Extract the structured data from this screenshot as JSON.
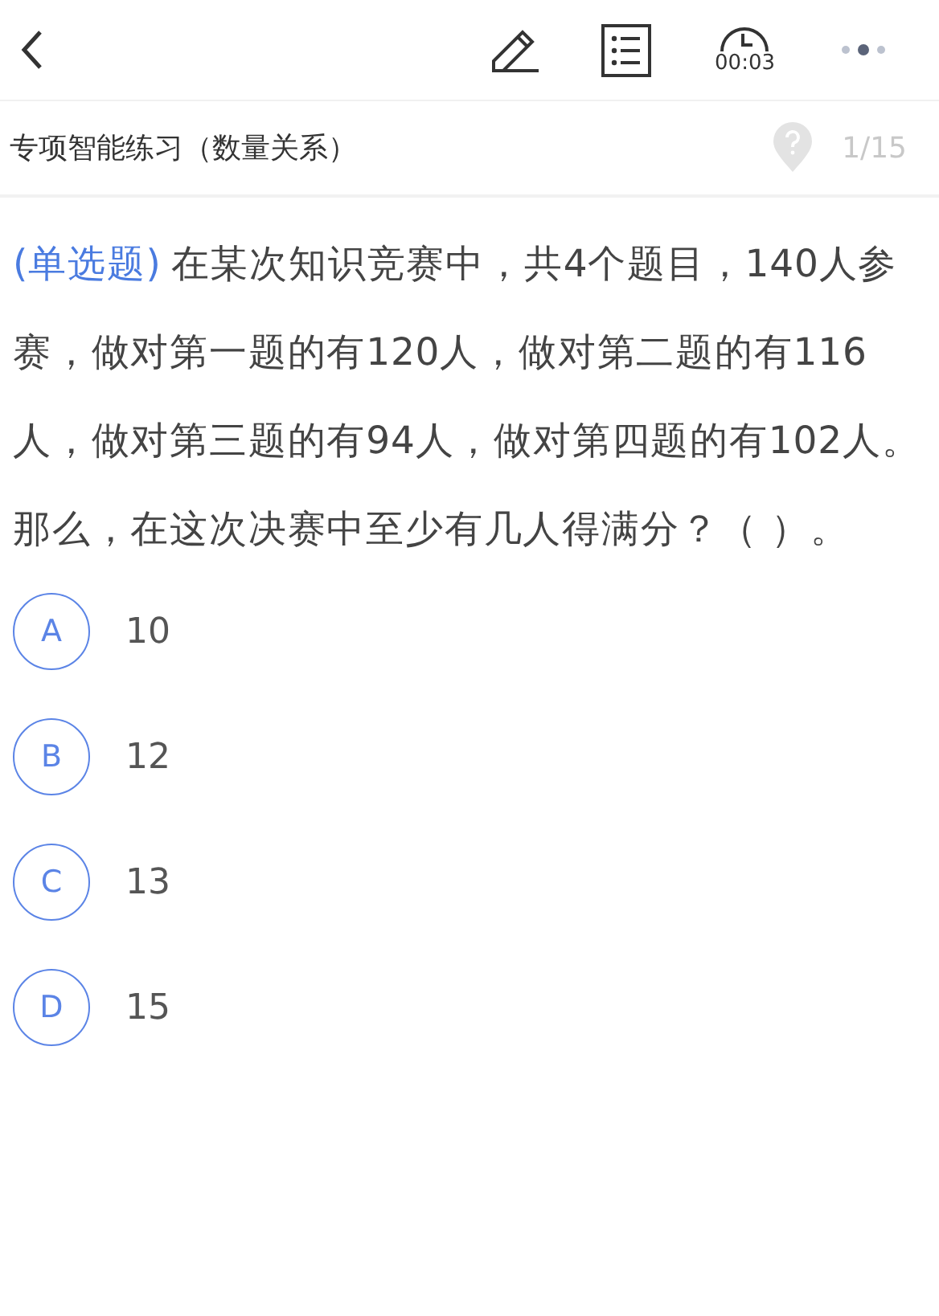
{
  "toolbar": {
    "timer": "00:03"
  },
  "subtitle": {
    "title": "专项智能练习（数量关系）",
    "progress": "1/15"
  },
  "question": {
    "type": "(单选题)",
    "text": "在某次知识竞赛中，共4个题目，140人参赛，做对第一题的有120人，做对第二题的有116人，做对第三题的有94人，做对第四题的有102人。那么，在这次决赛中至少有几人得满分？（ ）。"
  },
  "options": [
    {
      "letter": "A",
      "text": "10",
      "selected": false
    },
    {
      "letter": "B",
      "text": "12",
      "selected": false
    },
    {
      "letter": "C",
      "text": "13",
      "selected": false
    },
    {
      "letter": "D",
      "text": "15",
      "selected": false
    }
  ]
}
